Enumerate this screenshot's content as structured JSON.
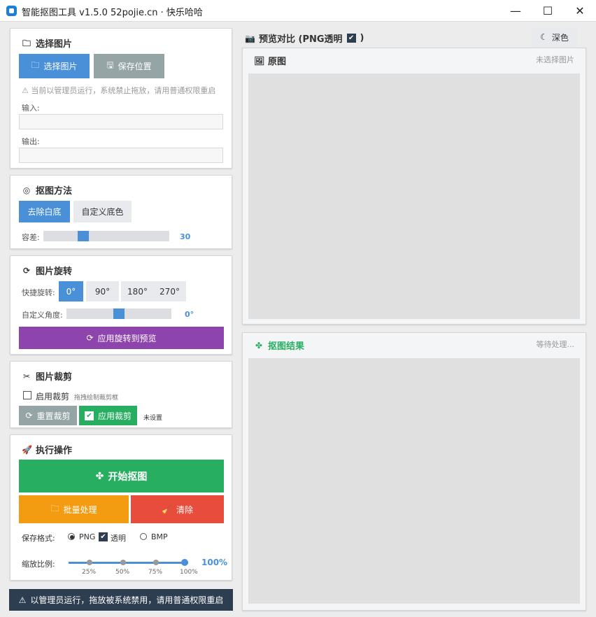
{
  "window": {
    "title": "智能抠图工具 v1.5.0 52pojie.cn · 快乐哈哈",
    "minimize_label": "—",
    "maximize_label": "☐",
    "close_label": "✕"
  },
  "select_section": {
    "title": "选择图片",
    "select_button": "选择图片",
    "save_location_button": "保存位置",
    "warning": "当前以管理员运行，系统禁止拖放，请用普通权限重启",
    "input_label": "输入:",
    "input_value": "",
    "output_label": "输出:",
    "output_value": ""
  },
  "method_section": {
    "title": "抠图方法",
    "tab_remove_white": "去除白底",
    "tab_custom_color": "自定义底色",
    "tolerance_label": "容差:",
    "tolerance_value": "30",
    "tolerance_fraction": 0.3
  },
  "rotate_section": {
    "title": "图片旋转",
    "quick_label": "快捷旋转:",
    "options": [
      "0°",
      "90°",
      "180°",
      "270°"
    ],
    "selected_option": "0°",
    "custom_label": "自定义角度:",
    "custom_value": "0°",
    "custom_fraction": 0.5,
    "apply_button": "应用旋转到预览"
  },
  "crop_section": {
    "title": "图片裁剪",
    "enable_label": "启用裁剪",
    "enable_checked": false,
    "hint": "拖拽绘制裁剪框",
    "reset_button": "重置裁剪",
    "apply_button": "应用裁剪",
    "status": "未设置"
  },
  "action_section": {
    "title": "执行操作",
    "start_button": "开始抠图",
    "batch_button": "批量处理",
    "clear_button": "清除",
    "format_label": "保存格式:",
    "format_png": "PNG",
    "transparent_label": "透明",
    "transparent_checked": true,
    "format_bmp": "BMP",
    "selected_format": "PNG",
    "scale_label": "缩放比例:",
    "scale_value": "100%",
    "scale_ticks": [
      "25%",
      "50%",
      "75%",
      "100%"
    ],
    "scale_fraction": 1.0
  },
  "status_bar": {
    "text": "以管理员运行，拖放被系统禁用，请用普通权限重启"
  },
  "preview": {
    "header_title": "预览对比 (PNG透明",
    "header_close": ")",
    "header_checked": true,
    "theme_button": "深色",
    "original_title": "原图",
    "original_status": "未选择图片",
    "result_title": "抠图结果",
    "result_status": "等待处理..."
  },
  "colors": {
    "accent_blue": "#4a90d9",
    "green": "#27ae60",
    "purple": "#8e44ad",
    "orange": "#f39c12",
    "red": "#e74c3c",
    "status_bar": "#2c3e50"
  },
  "icons": {
    "app": "app-logo-icon",
    "folder": "folder-icon",
    "save": "floppy-icon",
    "warning": "warning-triangle-icon",
    "method": "target-icon",
    "rotate": "rotate-icon",
    "crop": "scissors-icon",
    "rocket": "rocket-icon",
    "puzzle": "puzzle-icon",
    "broom": "broom-icon",
    "camera": "camera-icon",
    "image": "image-icon",
    "moon": "moon-icon",
    "check": "check-icon"
  }
}
